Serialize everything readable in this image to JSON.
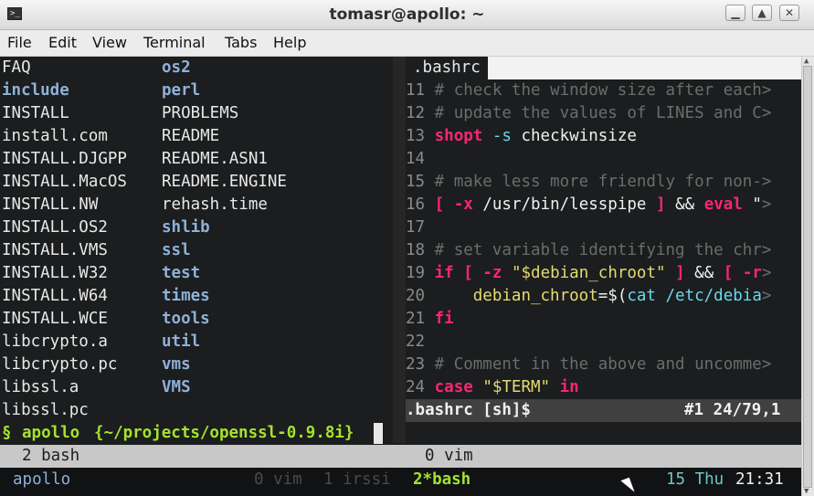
{
  "window": {
    "title": "tomasr@apollo: ~"
  },
  "menu": [
    "File",
    "Edit",
    "View",
    "Terminal",
    "Tabs",
    "Help"
  ],
  "left_pane": {
    "col1": [
      {
        "t": "FAQ",
        "dir": false
      },
      {
        "t": "include",
        "dir": true
      },
      {
        "t": "INSTALL",
        "dir": false
      },
      {
        "t": "install.com",
        "dir": false
      },
      {
        "t": "INSTALL.DJGPP",
        "dir": false
      },
      {
        "t": "INSTALL.MacOS",
        "dir": false
      },
      {
        "t": "INSTALL.NW",
        "dir": false
      },
      {
        "t": "INSTALL.OS2",
        "dir": false
      },
      {
        "t": "INSTALL.VMS",
        "dir": false
      },
      {
        "t": "INSTALL.W32",
        "dir": false
      },
      {
        "t": "INSTALL.W64",
        "dir": false
      },
      {
        "t": "INSTALL.WCE",
        "dir": false
      },
      {
        "t": "libcrypto.a",
        "dir": false
      },
      {
        "t": "libcrypto.pc",
        "dir": false
      },
      {
        "t": "libssl.a",
        "dir": false
      },
      {
        "t": "libssl.pc",
        "dir": false
      }
    ],
    "col2": [
      {
        "t": "os2",
        "dir": true
      },
      {
        "t": "perl",
        "dir": true
      },
      {
        "t": "PROBLEMS",
        "dir": false
      },
      {
        "t": "README",
        "dir": false
      },
      {
        "t": "README.ASN1",
        "dir": false
      },
      {
        "t": "README.ENGINE",
        "dir": false
      },
      {
        "t": "rehash.time",
        "dir": false
      },
      {
        "t": "shlib",
        "dir": true
      },
      {
        "t": "ssl",
        "dir": true
      },
      {
        "t": "test",
        "dir": true
      },
      {
        "t": "times",
        "dir": true
      },
      {
        "t": "tools",
        "dir": true
      },
      {
        "t": "util",
        "dir": true
      },
      {
        "t": "vms",
        "dir": true
      },
      {
        "t": "VMS",
        "dir": true
      }
    ],
    "prompt": {
      "symbol": "§",
      "host": "apollo",
      "path": "{~/projects/openssl-0.9.8i}"
    }
  },
  "vim": {
    "tab": ".bashrc",
    "lines": [
      {
        "n": "11",
        "segs": [
          [
            "# check the window size after each",
            "comment"
          ],
          [
            ">",
            "comment"
          ]
        ]
      },
      {
        "n": "12",
        "segs": [
          [
            "# update the values of LINES and C",
            "comment"
          ],
          [
            ">",
            "comment"
          ]
        ]
      },
      {
        "n": "13",
        "segs": [
          [
            "shopt",
            "pink"
          ],
          [
            " ",
            "text"
          ],
          [
            "-s",
            "cyan"
          ],
          [
            " checkwinsize",
            "text"
          ]
        ]
      },
      {
        "n": "14",
        "segs": []
      },
      {
        "n": "15",
        "segs": [
          [
            "# make less more friendly for non-",
            "comment"
          ],
          [
            ">",
            "comment"
          ]
        ]
      },
      {
        "n": "16",
        "segs": [
          [
            "[",
            "pink"
          ],
          [
            " ",
            "text"
          ],
          [
            "-x",
            "pink"
          ],
          [
            " /usr/bin/lesspipe ",
            "text"
          ],
          [
            "]",
            "pink"
          ],
          [
            " && ",
            "text"
          ],
          [
            "eval",
            "pink"
          ],
          [
            " \"",
            "text"
          ],
          [
            ">",
            "comment"
          ]
        ]
      },
      {
        "n": "17",
        "segs": []
      },
      {
        "n": "18",
        "segs": [
          [
            "# set variable identifying the chr",
            "comment"
          ],
          [
            ">",
            "comment"
          ]
        ]
      },
      {
        "n": "19",
        "segs": [
          [
            "if",
            "pink"
          ],
          [
            " ",
            "text"
          ],
          [
            "[",
            "pink"
          ],
          [
            " ",
            "text"
          ],
          [
            "-z",
            "pink"
          ],
          [
            " ",
            "text"
          ],
          [
            "\"$debian_chroot\"",
            "yellow"
          ],
          [
            " ",
            "text"
          ],
          [
            "]",
            "pink"
          ],
          [
            " && ",
            "text"
          ],
          [
            "[",
            "pink"
          ],
          [
            " ",
            "text"
          ],
          [
            "-r",
            "pink"
          ],
          [
            ">",
            "comment"
          ]
        ]
      },
      {
        "n": "20",
        "segs": [
          [
            "    debian_chroot",
            "yellow"
          ],
          [
            "=$(",
            "text"
          ],
          [
            "cat /etc/debia",
            "cyan"
          ],
          [
            ">",
            "comment"
          ]
        ]
      },
      {
        "n": "21",
        "segs": [
          [
            "fi",
            "pink"
          ]
        ]
      },
      {
        "n": "22",
        "segs": []
      },
      {
        "n": "23",
        "segs": [
          [
            "# Comment in the above and uncomme",
            "comment"
          ],
          [
            ">",
            "comment"
          ]
        ]
      },
      {
        "n": "24",
        "segs": [
          [
            "case",
            "pink"
          ],
          [
            " ",
            "text"
          ],
          [
            "\"$TERM\"",
            "yellow"
          ],
          [
            " ",
            "text"
          ],
          [
            "in",
            "pink"
          ]
        ]
      }
    ],
    "status_left": ".bashrc [sh]$",
    "status_right": "#1 24/79,1"
  },
  "tmux_panes": {
    "left": "2 bash",
    "right": "0 vim"
  },
  "statusbar": {
    "host": "apollo",
    "windows": [
      "0 vim",
      "1 irssi"
    ],
    "active": "2*bash",
    "date": "15 Thu",
    "time": "21:31"
  }
}
